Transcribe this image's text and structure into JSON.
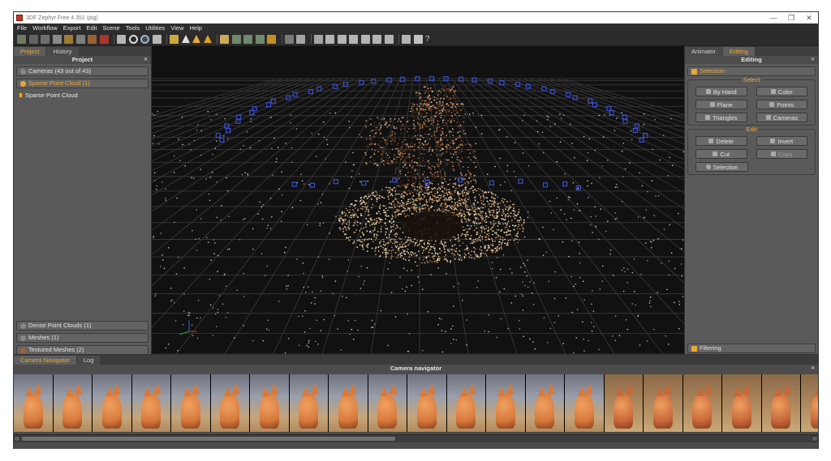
{
  "window": {
    "title": "3DF Zephyr Free 4.351 (pig)",
    "controls": [
      "—",
      "❐",
      "✕"
    ]
  },
  "menu": [
    "File",
    "Workflow",
    "Export",
    "Edit",
    "Scene",
    "Tools",
    "Utilities",
    "View",
    "Help"
  ],
  "toolbar": {
    "icons": [
      "new-project-icon",
      "open-project-icon",
      "save-icon",
      "sparse-cloud-icon",
      "dense-cloud-icon",
      "mesh-icon",
      "textured-mesh-icon",
      "record-icon",
      "camera-icon",
      "orbit-icon",
      "pan-icon",
      "box-icon",
      "light-icon",
      "points-mode-icon",
      "wireframe-mode-icon",
      "shaded-mode-icon",
      "brush-icon",
      "select-points-icon",
      "select-region-icon",
      "select-cameras-icon",
      "marker-icon",
      "grid-icon",
      "undo-icon",
      "redo-icon",
      "bbox-icon",
      "rotate-icon",
      "axis-icon",
      "measure-icon",
      "edit-icon",
      "filter-icon",
      "control-point-icon",
      "vr-icon",
      "help-icon"
    ],
    "help_glyph": "?"
  },
  "left_panel": {
    "tabs": [
      "Project",
      "History"
    ],
    "header": "Project",
    "cameras": "Cameras (43 out of 43)",
    "sparse": "Sparse Point Cloud (1)",
    "sparse_item": "Sparse Point Cloud",
    "dense": "Dense Point Clouds (1)",
    "meshes": "Meshes (1)",
    "textured": "Textured Meshes (2)"
  },
  "viewport": {
    "axis_label": "Z"
  },
  "right_panel": {
    "tabs": [
      "Animator",
      "Editing"
    ],
    "header": "Editing",
    "selection_bar": "Selection",
    "select_group": "Select",
    "select_buttons": [
      "By Hand",
      "Color",
      "Plane",
      "Points",
      "Triangles",
      "Cameras"
    ],
    "edit_group": "Edit",
    "edit_buttons": [
      "Delete",
      "Invert",
      "Cut",
      "Copy"
    ],
    "selection_button": "Selection",
    "filtering_bar": "Filtering"
  },
  "bottom_panel": {
    "tabs": [
      "Camera Navigator",
      "Log"
    ],
    "header": "Camera navigator",
    "thumbnail_count": 21
  },
  "colors": {
    "accent": "#e8a838",
    "panel": "#5a5a5a",
    "viewport": "#111111",
    "camera_marker": "#3a4fcf"
  }
}
